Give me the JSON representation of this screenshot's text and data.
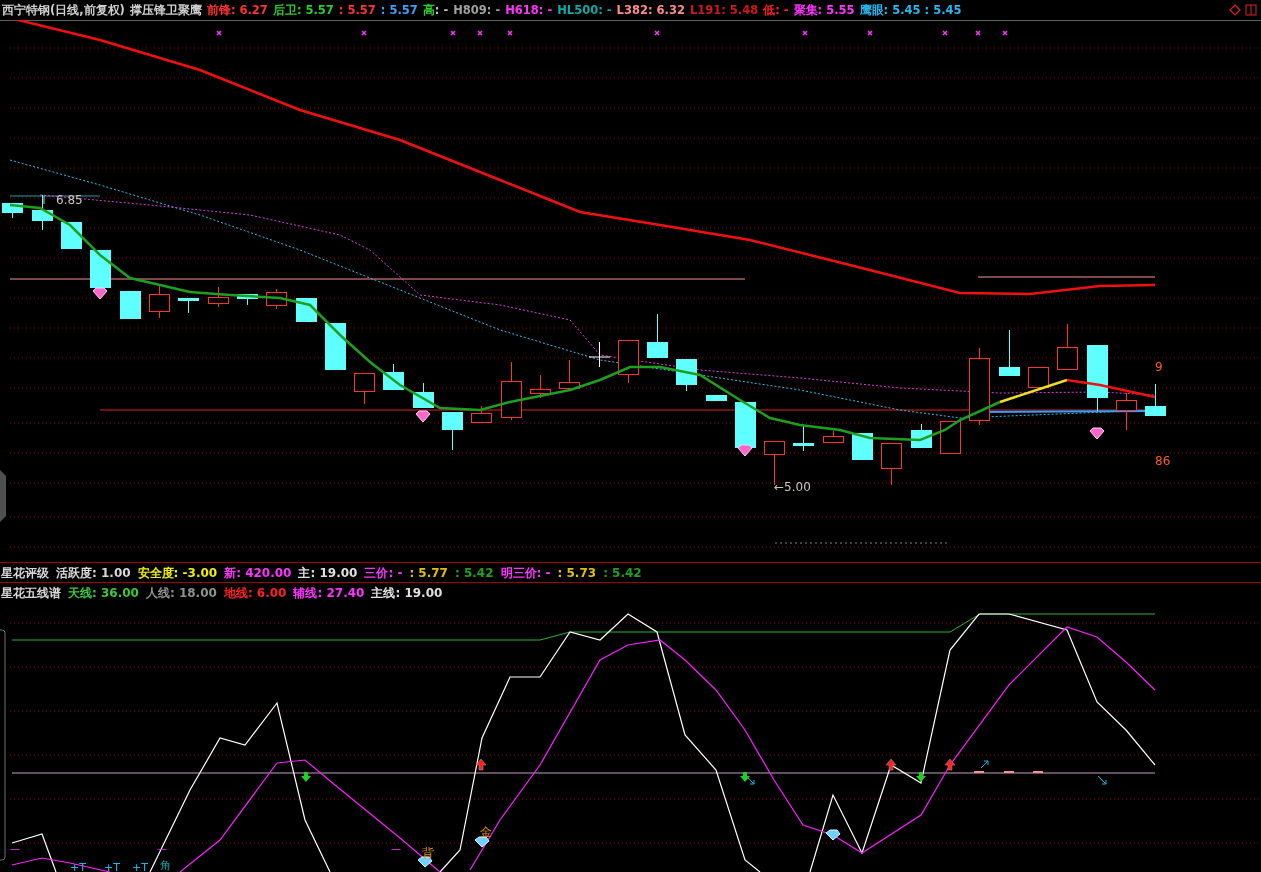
{
  "header": [
    {
      "parts": [
        {
          "text": "西宁特钢(日线,前复权)",
          "color": "#d0d0d0"
        }
      ]
    },
    {
      "parts": [
        {
          "text": "撑压锋卫聚鹰",
          "color": "#d0d0d0"
        }
      ]
    },
    {
      "parts": [
        {
          "text": "前锋: 6.27",
          "color": "#ff3232"
        }
      ]
    },
    {
      "parts": [
        {
          "text": "后卫: 5.57",
          "color": "#2ecc2e"
        }
      ]
    },
    {
      "parts": [
        {
          "text": ": 5.57",
          "color": "#ff3232"
        }
      ]
    },
    {
      "parts": [
        {
          "text": ": 5.57",
          "color": "#3aa0ff"
        }
      ]
    },
    {
      "parts": [
        {
          "text": "高",
          "color": "#2ecc2e"
        },
        {
          "text": ": -",
          "color": "#c0c0c0"
        }
      ]
    },
    {
      "parts": [
        {
          "text": "H809: -",
          "color": "#a0a0a0"
        }
      ]
    },
    {
      "parts": [
        {
          "text": "H618: -",
          "color": "#ff33ff"
        }
      ]
    },
    {
      "parts": [
        {
          "text": "HL500: -",
          "color": "#13a8a8"
        }
      ]
    },
    {
      "parts": [
        {
          "text": "L382: 6.32",
          "color": "#ff8c8c"
        }
      ]
    },
    {
      "parts": [
        {
          "text": "L191: 5.48",
          "color": "#d01818"
        }
      ]
    },
    {
      "parts": [
        {
          "text": "低: -",
          "color": "#ff2020"
        }
      ]
    },
    {
      "parts": [
        {
          "text": "聚集: 5.55",
          "color": "#ff33ff"
        }
      ]
    },
    {
      "parts": [
        {
          "text": "鹰眼: 5.45 : 5.45",
          "color": "#28b8f0"
        }
      ]
    }
  ],
  "main_chart": {
    "labels": [
      {
        "text": "6.85"
      },
      {
        "text": "←5.00"
      },
      {
        "text": "9"
      },
      {
        "text": "86"
      }
    ]
  },
  "indicator_rows": [
    [
      {
        "text": "星花评级",
        "color": "#d8d8d8"
      },
      {
        "text": "活跃度: 1.00",
        "color": "#d8d8d8"
      },
      {
        "text": "安全度: -3.00",
        "color": "#f0f000"
      },
      {
        "text": "新: 420.00",
        "color": "#ff33ff"
      },
      {
        "text": "主: 19.00",
        "color": "#e0e0e0"
      },
      {
        "text": "三价: -",
        "color": "#ff33ff"
      },
      {
        "text": ": 5.77",
        "color": "#e0c000"
      },
      {
        "text": ": 5.42",
        "color": "#20a020"
      },
      {
        "text": "明三价: -",
        "color": "#ff33ff"
      },
      {
        "text": ": 5.73",
        "color": "#e0c000"
      },
      {
        "text": ": 5.42",
        "color": "#20a020"
      }
    ],
    [
      {
        "text": "星花五线谱",
        "color": "#d8d8d8"
      },
      {
        "text": "天线: 36.00",
        "color": "#3cc83c"
      },
      {
        "text": "人线: 18.00",
        "color": "#909090"
      },
      {
        "text": "地线: 6.00",
        "color": "#ff2020"
      },
      {
        "text": "辅线: 27.40",
        "color": "#ff33ff"
      },
      {
        "text": "主线: 19.00",
        "color": "#e0e0e0"
      }
    ]
  ],
  "lower_chart": {
    "labels": [
      {
        "text": "背"
      },
      {
        "text": "金"
      },
      {
        "text": "—"
      },
      {
        "text": "—"
      },
      {
        "text": "—"
      },
      {
        "text": "+T"
      },
      {
        "text": "+T"
      },
      {
        "text": "+T"
      },
      {
        "text": "角"
      }
    ]
  }
}
